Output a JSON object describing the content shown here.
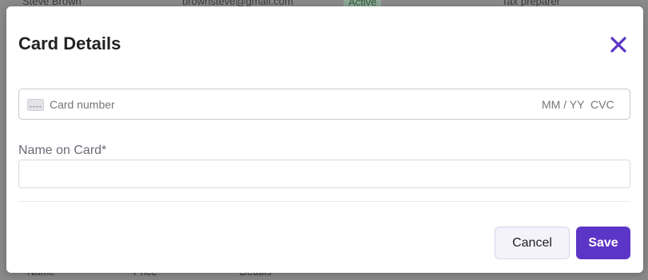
{
  "background": {
    "top_row": {
      "name": "Steve Brown",
      "email": "brownsteve@gmail.com",
      "status": "Active",
      "role": "Tax preparer"
    },
    "bottom_row": {
      "col1": "Name",
      "col2": "Price",
      "col3": "Details"
    }
  },
  "modal": {
    "title": "Card Details",
    "close_icon": "close-icon",
    "card_field": {
      "icon": "credit-card-icon",
      "number_placeholder": "Card number",
      "expiry_placeholder": "MM / YY",
      "cvc_placeholder": "CVC"
    },
    "name_field": {
      "label": "Name on Card*",
      "value": ""
    },
    "buttons": {
      "cancel_label": "Cancel",
      "save_label": "Save"
    }
  },
  "colors": {
    "accent": "#5b35c5",
    "close_icon": "#5b35c5",
    "cancel_bg": "#f4f2fb"
  }
}
